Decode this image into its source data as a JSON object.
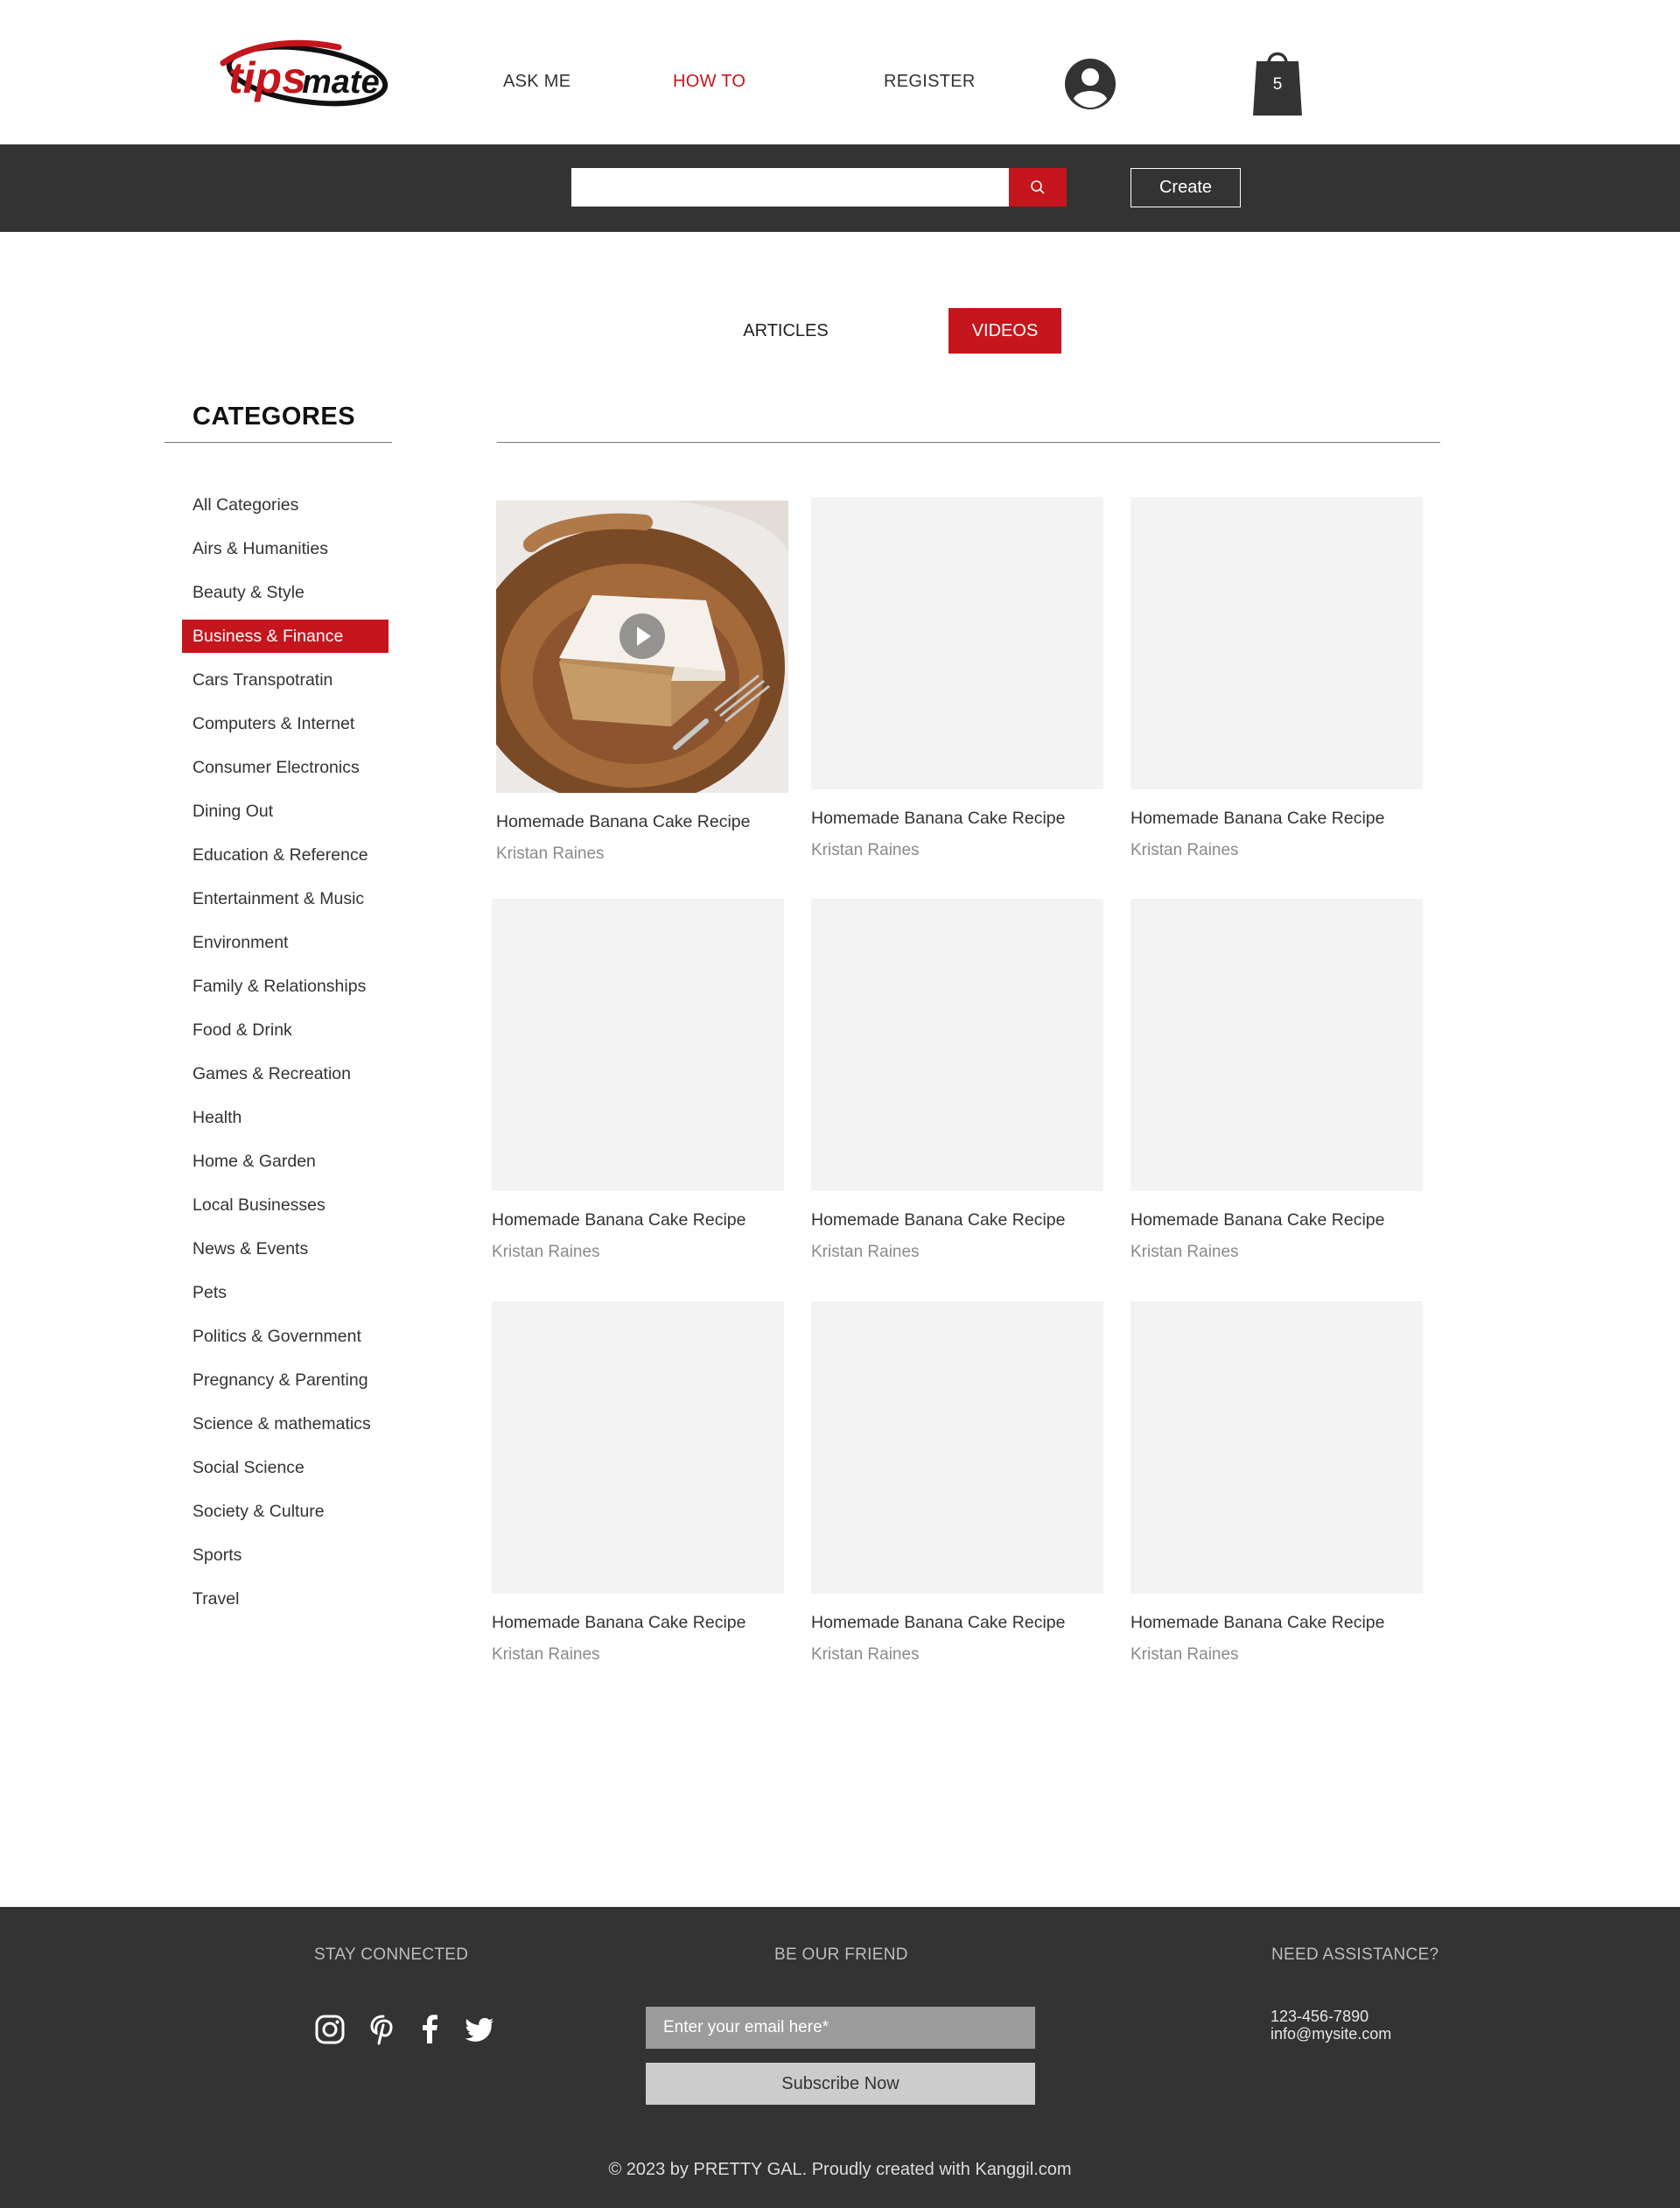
{
  "header": {
    "logo_text": "tipsmate",
    "nav": [
      {
        "label": "ASK ME"
      },
      {
        "label": "HOW TO"
      },
      {
        "label": "REGISTER"
      }
    ],
    "cart_count": "5"
  },
  "search": {
    "placeholder": "",
    "create_label": "Create"
  },
  "tabs": {
    "articles": "ARTICLES",
    "videos": "VIDEOS"
  },
  "sidebar": {
    "title": "CATEGORES",
    "items": [
      {
        "label": "All Categories"
      },
      {
        "label": "Airs & Humanities"
      },
      {
        "label": "Beauty & Style"
      },
      {
        "label": "Business & Finance"
      },
      {
        "label": "Cars Transpotratin"
      },
      {
        "label": "Computers & Internet"
      },
      {
        "label": "Consumer Electronics"
      },
      {
        "label": "Dining Out"
      },
      {
        "label": "Education & Reference"
      },
      {
        "label": "Entertainment & Music"
      },
      {
        "label": "Environment"
      },
      {
        "label": "Family & Relationships"
      },
      {
        "label": "Food & Drink"
      },
      {
        "label": "Games & Recreation"
      },
      {
        "label": "Health"
      },
      {
        "label": "Home & Garden"
      },
      {
        "label": "Local Businesses"
      },
      {
        "label": "News & Events"
      },
      {
        "label": "Pets"
      },
      {
        "label": "Politics & Government"
      },
      {
        "label": "Pregnancy & Parenting"
      },
      {
        "label": "Science & mathematics"
      },
      {
        "label": "Social Science"
      },
      {
        "label": "Society & Culture"
      },
      {
        "label": "Sports"
      },
      {
        "label": "Travel"
      }
    ]
  },
  "videos": [
    {
      "title": "Homemade Banana Cake Recipe",
      "author": "Kristan Raines"
    },
    {
      "title": "Homemade Banana Cake Recipe",
      "author": "Kristan Raines"
    },
    {
      "title": "Homemade Banana Cake Recipe",
      "author": "Kristan Raines"
    },
    {
      "title": "Homemade Banana Cake Recipe",
      "author": "Kristan Raines"
    },
    {
      "title": "Homemade Banana Cake Recipe",
      "author": "Kristan Raines"
    },
    {
      "title": "Homemade Banana Cake Recipe",
      "author": "Kristan Raines"
    },
    {
      "title": "Homemade Banana Cake Recipe",
      "author": "Kristan Raines"
    },
    {
      "title": "Homemade Banana Cake Recipe",
      "author": "Kristan Raines"
    },
    {
      "title": "Homemade Banana Cake Recipe",
      "author": "Kristan Raines"
    }
  ],
  "footer": {
    "stay_connected": "STAY CONNECTED",
    "be_our_friend": "BE OUR FRIEND",
    "need_assistance": "NEED ASSISTANCE?",
    "email_placeholder": "Enter your email here*",
    "subscribe_label": "Subscribe Now",
    "phone": "123-456-7890",
    "email": "info@mysite.com",
    "copyright": "© 2023 by PRETTY GAL. Proudly created with Kanggil.com"
  },
  "colors": {
    "accent": "#c4161c",
    "dark": "#333333",
    "placeholder": "#f3f3f3"
  }
}
